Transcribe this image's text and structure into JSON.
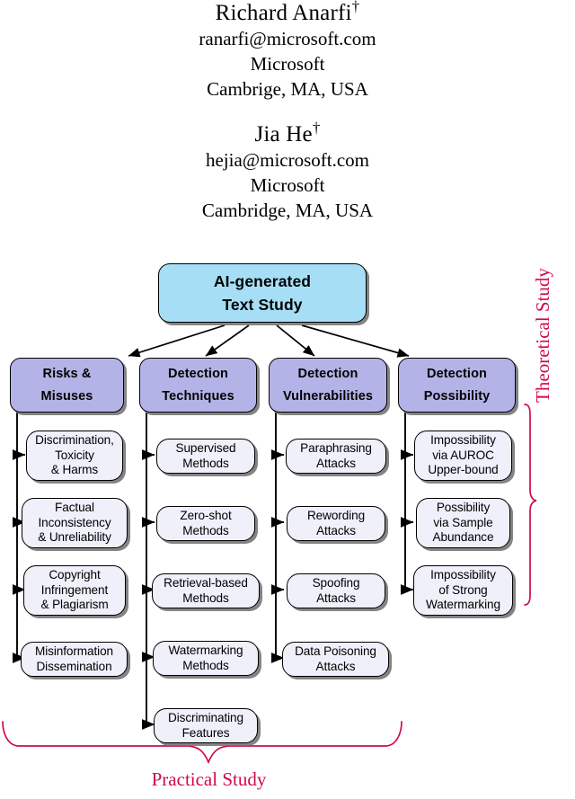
{
  "authors": [
    {
      "name": "Richard Anarfi",
      "dagger": "†",
      "email": "ranarfi@microsoft.com",
      "affiliation": "Microsoft",
      "location": "Cambrige, MA, USA"
    },
    {
      "name": "Jia He",
      "dagger": "†",
      "email": "hejia@microsoft.com",
      "affiliation": "Microsoft",
      "location": "Cambridge, MA, USA"
    }
  ],
  "diagram": {
    "root": {
      "label": "AI-generated\nText Study",
      "color": "#a6dff5"
    },
    "category_color": "#b4b3e8",
    "leaf_color": "#eff0fa",
    "brace_color": "#cf0a4b",
    "columns": [
      {
        "header": "Risks  &\nMisuses",
        "leaves": [
          "Discrimination,\nToxicity\n& Harms",
          "Factual\nInconsistency\n& Unreliability",
          "Copyright\nInfringement\n& Plagiarism",
          "Misinformation\nDissemination"
        ]
      },
      {
        "header": "Detection\nTechniques",
        "leaves": [
          "Supervised\nMethods",
          "Zero-shot\nMethods",
          "Retrieval-based\nMethods",
          "Watermarking\nMethods",
          "Discriminating\nFeatures"
        ]
      },
      {
        "header": "Detection\nVulnerabilities",
        "leaves": [
          "Paraphrasing\nAttacks",
          "Rewording\nAttacks",
          "Spoofing\nAttacks",
          "Data Poisoning\nAttacks"
        ]
      },
      {
        "header": "Detection\nPossibility",
        "leaves": [
          "Impossibility\nvia AUROC\nUpper-bound",
          "Possibility\nvia Sample\nAbundance",
          "Impossibility\nof Strong\nWatermarking"
        ]
      }
    ],
    "braces": {
      "theoretical": "Theoretical Study",
      "practical": "Practical Study"
    }
  }
}
